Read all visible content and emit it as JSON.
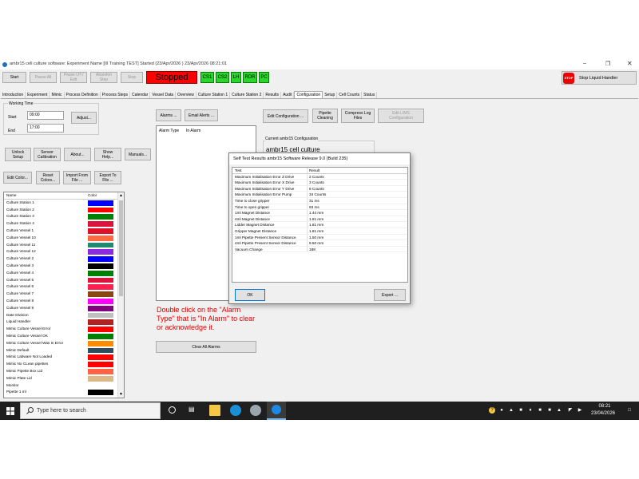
{
  "window": {
    "title": "ambr15 cell culture software: Experiment Name [III Training TEST] Started (23/Apr/2026 ) 23/Apr/2026 08:21:01"
  },
  "toolbar": {
    "start": "Start",
    "pause_all": "Pause All",
    "pause_lh_edit": "Pause LH /\nEdit",
    "abandon_step": "Abandon\nStep",
    "stop": "Stop",
    "status": "Stopped",
    "cs1": "CS1",
    "cs2": "CS2",
    "lh": "LH",
    "rdr": "RDR",
    "pc": "PC",
    "stop_icon": "STOP",
    "stop_liquid_handler": "Stop Liquid Handler"
  },
  "tabs": [
    "Introduction",
    "Experiment",
    "Mimic",
    "Process Definition",
    "Process Steps",
    "Calendar",
    "Vessel Data",
    "Overview",
    "Culture Station 1",
    "Culture Station 2",
    "Results",
    "Audit",
    "Configuration",
    "Setup",
    "Cell Counts",
    "Status"
  ],
  "active_tab": "Configuration",
  "working_time": {
    "title": "Working Time",
    "start_label": "Start",
    "start_value": "09:00",
    "end_label": "End",
    "end_value": "17:00",
    "adjust": "Adjust..."
  },
  "left_buttons": {
    "unlock_setup": "Unlock\nSetup",
    "sensor_calibration": "Sensor\nCalibration",
    "about": "About...",
    "show_help": "Show\nHelp...",
    "manuals": "Manuals...",
    "edit_color": "Edit Color...",
    "reset_colors": "Reset\nColors...",
    "import_from_file": "Import From\nFile ...",
    "export_to_file": "Export To\nFile ..."
  },
  "color_table": {
    "headers": [
      "Name",
      "Color"
    ],
    "rows": [
      {
        "name": "Culture Station 1",
        "color": "#0000ff"
      },
      {
        "name": "Culture Station 2",
        "color": "#ff0000"
      },
      {
        "name": "Culture Station 3",
        "color": "#008000"
      },
      {
        "name": "Culture Station 4",
        "color": "#dc143c"
      },
      {
        "name": "Culture Vessel 1",
        "color": "#e0102a"
      },
      {
        "name": "Culture Vessel 10",
        "color": "#ff6a40"
      },
      {
        "name": "Culture Vessel 11",
        "color": "#1f8a70"
      },
      {
        "name": "Culture Vessel 12",
        "color": "#8a2be2"
      },
      {
        "name": "Culture Vessel 2",
        "color": "#0000ff"
      },
      {
        "name": "Culture Vessel 3",
        "color": "#000000"
      },
      {
        "name": "Culture Vessel 4",
        "color": "#008000"
      },
      {
        "name": "Culture Vessel 5",
        "color": "#dc143c"
      },
      {
        "name": "Culture Vessel 6",
        "color": "#ff2050"
      },
      {
        "name": "Culture Vessel 7",
        "color": "#8b4513"
      },
      {
        "name": "Culture Vessel 8",
        "color": "#ff00ff"
      },
      {
        "name": "Culture Vessel 9",
        "color": "#800080"
      },
      {
        "name": "Date Division",
        "color": "#c0c0c0"
      },
      {
        "name": "Liquid Handler",
        "color": "#b22222"
      },
      {
        "name": "Mimic Culture Vessel Error",
        "color": "#ff0000"
      },
      {
        "name": "Mimic Culture Vessel OK",
        "color": "#008000"
      },
      {
        "name": "Mimic Culture Vessel Was In Error",
        "color": "#ff8c00"
      },
      {
        "name": "Mimic Default",
        "color": "#2e4d5c"
      },
      {
        "name": "Mimic Labware Not Loaded",
        "color": "#ff0000"
      },
      {
        "name": "Mimic No CLean pipettes",
        "color": "#ff0000"
      },
      {
        "name": "Mimic Pipette Box Lid",
        "color": "#ff6347"
      },
      {
        "name": "Mimic Plate Lid",
        "color": "#deb887"
      },
      {
        "name": "Monitor",
        "color": "#ffffff"
      },
      {
        "name": "Pipette 1 ml",
        "color": "#000000"
      }
    ]
  },
  "alarms": {
    "alarms_btn": "Alarms ...",
    "email_alerts": "Email Alerts ...",
    "col_alarm_type": "Alarm Type",
    "col_in_alarm": "In Alarm",
    "note": "Double click on the \"Alarm Type\" that is \"In Alarm\" to clear or acknowledge it.",
    "clear_all": "Clear All Alarms"
  },
  "config_buttons": {
    "edit_configuration": "Edit Configuration ...",
    "pipette_cleaning": "Pipette\nCleaning",
    "compress_log_files": "Compress Log\nFiles",
    "edit_lims": "Edit LIMS\nConfiguration"
  },
  "current_config": {
    "label": "Current ambr15 Configuration",
    "partial_text": "ambr15 cell culture"
  },
  "dialog": {
    "title": "Self Test Results ambr15 Software Release 9.0 (Build 235)",
    "headers": [
      "Test",
      "Result"
    ],
    "rows": [
      {
        "test": "Maximum Initialisation Error Z Drive",
        "result": "2 Counts"
      },
      {
        "test": "Maximum Initialisation Error X Drive",
        "result": "3 Counts"
      },
      {
        "test": "Maximum Initialisation Error Y Drive",
        "result": "6 Counts"
      },
      {
        "test": "Maximum Initialisation Error Pump",
        "result": "34 Counts"
      },
      {
        "test": "Time to close gripper",
        "result": "31 ms"
      },
      {
        "test": "Time to open gripper",
        "result": "93 ms"
      },
      {
        "test": "1ml Magnet Distance",
        "result": "1.44 mm"
      },
      {
        "test": "4ml Magnet Distance",
        "result": "1.81 mm"
      },
      {
        "test": "Lidder Magnet Distance",
        "result": "1.81 mm"
      },
      {
        "test": "Gripper Magnet Distance",
        "result": "1.81 mm"
      },
      {
        "test": "1ml Pipette Present Sensor Distance",
        "result": "1.50 mm"
      },
      {
        "test": "4ml Pipette Present Sensor Distance",
        "result": "9.50 mm"
      },
      {
        "test": "Vacuum Change",
        "result": "188"
      }
    ],
    "ok": "OK",
    "export": "Export ..."
  },
  "taskbar": {
    "search_placeholder": "Type here to search",
    "time": "08:21",
    "date": "23/04/2026"
  }
}
